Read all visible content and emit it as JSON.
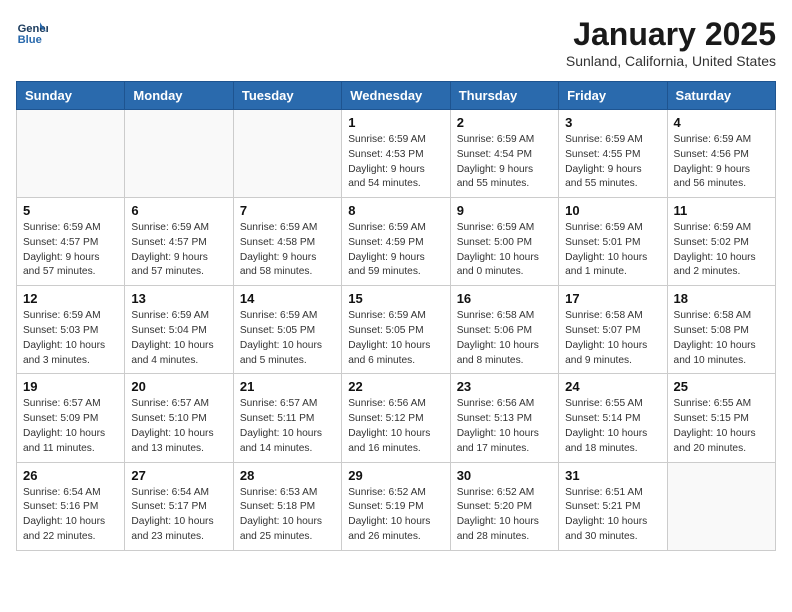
{
  "header": {
    "logo_line1": "General",
    "logo_line2": "Blue",
    "month": "January 2025",
    "location": "Sunland, California, United States"
  },
  "days_of_week": [
    "Sunday",
    "Monday",
    "Tuesday",
    "Wednesday",
    "Thursday",
    "Friday",
    "Saturday"
  ],
  "weeks": [
    [
      {
        "day": "",
        "info": ""
      },
      {
        "day": "",
        "info": ""
      },
      {
        "day": "",
        "info": ""
      },
      {
        "day": "1",
        "info": "Sunrise: 6:59 AM\nSunset: 4:53 PM\nDaylight: 9 hours\nand 54 minutes."
      },
      {
        "day": "2",
        "info": "Sunrise: 6:59 AM\nSunset: 4:54 PM\nDaylight: 9 hours\nand 55 minutes."
      },
      {
        "day": "3",
        "info": "Sunrise: 6:59 AM\nSunset: 4:55 PM\nDaylight: 9 hours\nand 55 minutes."
      },
      {
        "day": "4",
        "info": "Sunrise: 6:59 AM\nSunset: 4:56 PM\nDaylight: 9 hours\nand 56 minutes."
      }
    ],
    [
      {
        "day": "5",
        "info": "Sunrise: 6:59 AM\nSunset: 4:57 PM\nDaylight: 9 hours\nand 57 minutes."
      },
      {
        "day": "6",
        "info": "Sunrise: 6:59 AM\nSunset: 4:57 PM\nDaylight: 9 hours\nand 57 minutes."
      },
      {
        "day": "7",
        "info": "Sunrise: 6:59 AM\nSunset: 4:58 PM\nDaylight: 9 hours\nand 58 minutes."
      },
      {
        "day": "8",
        "info": "Sunrise: 6:59 AM\nSunset: 4:59 PM\nDaylight: 9 hours\nand 59 minutes."
      },
      {
        "day": "9",
        "info": "Sunrise: 6:59 AM\nSunset: 5:00 PM\nDaylight: 10 hours\nand 0 minutes."
      },
      {
        "day": "10",
        "info": "Sunrise: 6:59 AM\nSunset: 5:01 PM\nDaylight: 10 hours\nand 1 minute."
      },
      {
        "day": "11",
        "info": "Sunrise: 6:59 AM\nSunset: 5:02 PM\nDaylight: 10 hours\nand 2 minutes."
      }
    ],
    [
      {
        "day": "12",
        "info": "Sunrise: 6:59 AM\nSunset: 5:03 PM\nDaylight: 10 hours\nand 3 minutes."
      },
      {
        "day": "13",
        "info": "Sunrise: 6:59 AM\nSunset: 5:04 PM\nDaylight: 10 hours\nand 4 minutes."
      },
      {
        "day": "14",
        "info": "Sunrise: 6:59 AM\nSunset: 5:05 PM\nDaylight: 10 hours\nand 5 minutes."
      },
      {
        "day": "15",
        "info": "Sunrise: 6:59 AM\nSunset: 5:05 PM\nDaylight: 10 hours\nand 6 minutes."
      },
      {
        "day": "16",
        "info": "Sunrise: 6:58 AM\nSunset: 5:06 PM\nDaylight: 10 hours\nand 8 minutes."
      },
      {
        "day": "17",
        "info": "Sunrise: 6:58 AM\nSunset: 5:07 PM\nDaylight: 10 hours\nand 9 minutes."
      },
      {
        "day": "18",
        "info": "Sunrise: 6:58 AM\nSunset: 5:08 PM\nDaylight: 10 hours\nand 10 minutes."
      }
    ],
    [
      {
        "day": "19",
        "info": "Sunrise: 6:57 AM\nSunset: 5:09 PM\nDaylight: 10 hours\nand 11 minutes."
      },
      {
        "day": "20",
        "info": "Sunrise: 6:57 AM\nSunset: 5:10 PM\nDaylight: 10 hours\nand 13 minutes."
      },
      {
        "day": "21",
        "info": "Sunrise: 6:57 AM\nSunset: 5:11 PM\nDaylight: 10 hours\nand 14 minutes."
      },
      {
        "day": "22",
        "info": "Sunrise: 6:56 AM\nSunset: 5:12 PM\nDaylight: 10 hours\nand 16 minutes."
      },
      {
        "day": "23",
        "info": "Sunrise: 6:56 AM\nSunset: 5:13 PM\nDaylight: 10 hours\nand 17 minutes."
      },
      {
        "day": "24",
        "info": "Sunrise: 6:55 AM\nSunset: 5:14 PM\nDaylight: 10 hours\nand 18 minutes."
      },
      {
        "day": "25",
        "info": "Sunrise: 6:55 AM\nSunset: 5:15 PM\nDaylight: 10 hours\nand 20 minutes."
      }
    ],
    [
      {
        "day": "26",
        "info": "Sunrise: 6:54 AM\nSunset: 5:16 PM\nDaylight: 10 hours\nand 22 minutes."
      },
      {
        "day": "27",
        "info": "Sunrise: 6:54 AM\nSunset: 5:17 PM\nDaylight: 10 hours\nand 23 minutes."
      },
      {
        "day": "28",
        "info": "Sunrise: 6:53 AM\nSunset: 5:18 PM\nDaylight: 10 hours\nand 25 minutes."
      },
      {
        "day": "29",
        "info": "Sunrise: 6:52 AM\nSunset: 5:19 PM\nDaylight: 10 hours\nand 26 minutes."
      },
      {
        "day": "30",
        "info": "Sunrise: 6:52 AM\nSunset: 5:20 PM\nDaylight: 10 hours\nand 28 minutes."
      },
      {
        "day": "31",
        "info": "Sunrise: 6:51 AM\nSunset: 5:21 PM\nDaylight: 10 hours\nand 30 minutes."
      },
      {
        "day": "",
        "info": ""
      }
    ]
  ]
}
